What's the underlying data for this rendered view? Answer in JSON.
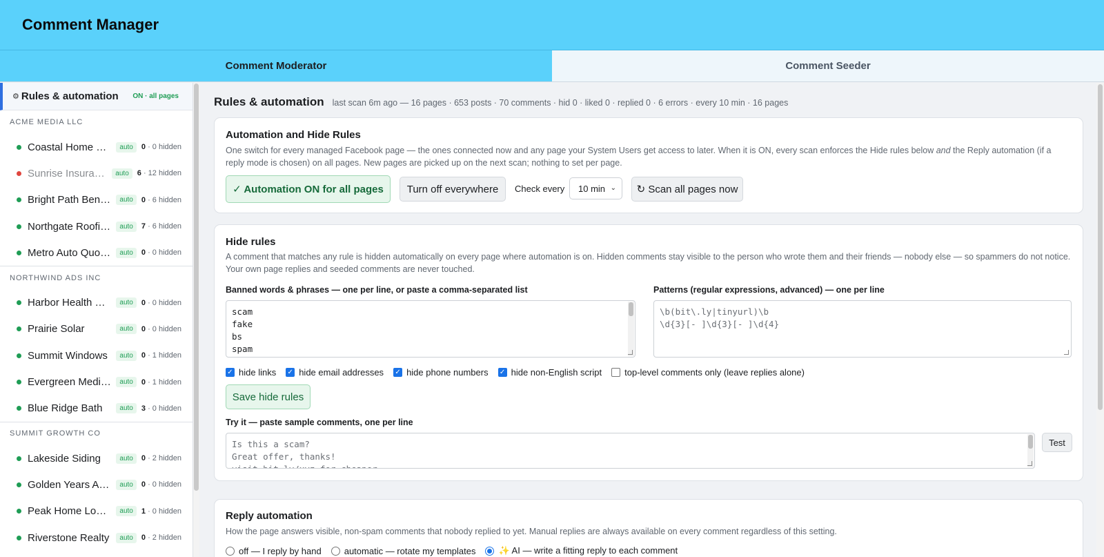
{
  "app": {
    "title": "Comment Manager"
  },
  "tabs": [
    {
      "label": "Comment Moderator",
      "active": true
    },
    {
      "label": "Comment Seeder",
      "active": false
    }
  ],
  "sidebar": {
    "top": {
      "icon": "gear-icon",
      "label": "Rules & automation",
      "status": "ON · all pages"
    },
    "groups": [
      {
        "name": "ACME MEDIA LLC",
        "pages": [
          {
            "name": "Coastal Home Services",
            "status": "green",
            "badge": "auto",
            "count": "0",
            "hidden": "· 0 hidden"
          },
          {
            "name": "Sunrise Insurance",
            "status": "red",
            "badge": "auto",
            "count": "6",
            "hidden": "· 12 hidden"
          },
          {
            "name": "Bright Path Benefits",
            "status": "green",
            "badge": "auto",
            "count": "0",
            "hidden": "· 6 hidden"
          },
          {
            "name": "Northgate Roofing",
            "status": "green",
            "badge": "auto",
            "count": "7",
            "hidden": "· 6 hidden"
          },
          {
            "name": "Metro Auto Quotes",
            "status": "green",
            "badge": "auto",
            "count": "0",
            "hidden": "· 0 hidden"
          }
        ]
      },
      {
        "name": "NORTHWIND ADS INC",
        "pages": [
          {
            "name": "Harbor Health Plans",
            "status": "green",
            "badge": "auto",
            "count": "0",
            "hidden": "· 0 hidden"
          },
          {
            "name": "Prairie Solar",
            "status": "green",
            "badge": "auto",
            "count": "0",
            "hidden": "· 0 hidden"
          },
          {
            "name": "Summit Windows",
            "status": "green",
            "badge": "auto",
            "count": "0",
            "hidden": "· 1 hidden"
          },
          {
            "name": "Evergreen Medicare",
            "status": "green",
            "badge": "auto",
            "count": "0",
            "hidden": "· 1 hidden"
          },
          {
            "name": "Blue Ridge Bath",
            "status": "green",
            "badge": "auto",
            "count": "3",
            "hidden": "· 0 hidden"
          }
        ]
      },
      {
        "name": "SUMMIT GROWTH CO",
        "pages": [
          {
            "name": "Lakeside Siding",
            "status": "green",
            "badge": "auto",
            "count": "0",
            "hidden": "· 2 hidden"
          },
          {
            "name": "Golden Years Advisors",
            "status": "green",
            "badge": "auto",
            "count": "0",
            "hidden": "· 0 hidden"
          },
          {
            "name": "Peak Home Loans",
            "status": "green",
            "badge": "auto",
            "count": "1",
            "hidden": "· 0 hidden"
          },
          {
            "name": "Riverstone Realty",
            "status": "green",
            "badge": "auto",
            "count": "0",
            "hidden": "· 2 hidden"
          }
        ]
      }
    ]
  },
  "main": {
    "title": "Rules & automation",
    "subtitle": "last scan 6m ago — 16 pages · 653 posts · 70 comments · hid 0 · liked 0 · replied 0 · 6 errors · every 10 min · 16 pages",
    "automation": {
      "title": "Automation and Hide Rules",
      "desc_before": "One switch for every managed Facebook page — the ones connected now and any page your System Users get access to later. When it is ON, every scan enforces the Hide rules below ",
      "desc_em": "and",
      "desc_after": " the Reply automation (if a reply mode is chosen) on all pages. New pages are picked up on the next scan; nothing to set per page.",
      "on_button": "✓ Automation ON for all pages",
      "off_button": "Turn off everywhere",
      "check_label": "Check every",
      "interval": "10 min",
      "scan_button": "↻ Scan all pages now"
    },
    "hide": {
      "title": "Hide rules",
      "desc": "A comment that matches any rule is hidden automatically on every page where automation is on. Hidden comments stay visible to the person who wrote them and their friends — nobody else — so spammers do not notice. Your own page replies and seeded comments are never touched.",
      "banned_label": "Banned words & phrases — one per line, or paste a comma-separated list",
      "banned_words": [
        "scam",
        "fake",
        "bs",
        "spam"
      ],
      "patterns_label": "Patterns (regular expressions, advanced) — one per line",
      "patterns": [
        "\\b(bit\\.ly|tinyurl)\\b",
        "\\d{3}[- ]\\d{3}[- ]\\d{4}"
      ],
      "options": [
        {
          "label": "hide links",
          "checked": true
        },
        {
          "label": "hide email addresses",
          "checked": true
        },
        {
          "label": "hide phone numbers",
          "checked": true
        },
        {
          "label": "hide non-English script",
          "checked": true
        },
        {
          "label": "top-level comments only (leave replies alone)",
          "checked": false
        }
      ],
      "save_button": "Save hide rules",
      "try_label": "Try it — paste sample comments, one per line",
      "try_samples": [
        "Is this a scam?",
        "Great offer, thanks!",
        "visit bit.ly/xyz for cheaper"
      ],
      "test_button": "Test"
    },
    "reply": {
      "title": "Reply automation",
      "desc": "How the page answers visible, non-spam comments that nobody replied to yet. Manual replies are always available on every comment regardless of this setting.",
      "modes": [
        {
          "label": "off — I reply by hand",
          "checked": false
        },
        {
          "label": "automatic — rotate my templates",
          "checked": false
        },
        {
          "label": "✨ AI — write a fitting reply to each comment",
          "checked": true
        }
      ]
    }
  },
  "colors": {
    "header": "#5ad1fb",
    "accent": "#1a73e8",
    "ok": "#1f9d55",
    "error": "#e0463f"
  }
}
